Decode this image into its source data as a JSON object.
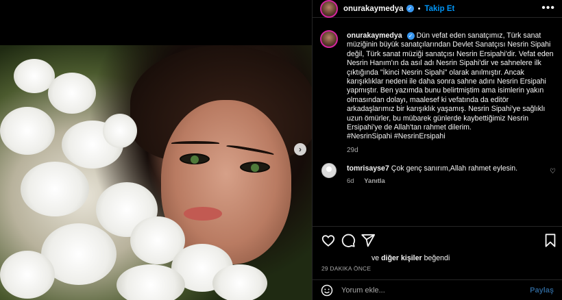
{
  "header": {
    "username": "onurakaymedya",
    "follow_label": "Takip Et",
    "dot": "•",
    "more_label": "•••"
  },
  "caption": {
    "username": "onurakaymedya",
    "text": "Dün vefat eden sanatçımız, Türk sanat müziğinin büyük sanatçılarından Devlet Sanatçısı Nesrin Sipahi değil, Türk sanat müziği sanatçısı Nesrin Ersipahi'dir. Vefat eden Nesrin Hanım'ın da asıl adı Nesrin Sipahi'dir ve sahnelere ilk çıktığında \"İkinci Nesrin Sipahi\" olarak anılmıştır. Ancak karışıklıklar nedeni ile daha sonra sahne adını Nesrin Ersipahi yapmıştır. Ben yazımda bunu belirtmiştim ama isimlerin yakın olmasından dolayı, maalesef ki vefatında da editör arkadaşlarımız bir karışıklık yaşamış. Nesrin Sipahi'ye sağlıklı uzun ömürler, bu mübarek günlerde kaybettiğimiz Nesrin Ersipahi'ye de Allah'tan rahmet dilerim.",
    "hashtags": "#NesrinSipahi #NesrinErsipahi",
    "time": "29d"
  },
  "comment": {
    "username": "tomrisayse7",
    "text": "Çok genç sanırım,Allah rahmet eylesin.",
    "time": "6d",
    "reply_label": "Yanıtla"
  },
  "likes": {
    "prefix": "ve",
    "others": "diğer kişiler",
    "suffix": "beğendi"
  },
  "time_ago": "29 dakika önce",
  "composer": {
    "placeholder": "Yorum ekle...",
    "post_label": "Paylaş"
  },
  "icons": {
    "verified": "verified-badge-icon",
    "like": "heart-icon",
    "comment": "comment-icon",
    "share": "share-icon",
    "save": "bookmark-icon",
    "emoji": "emoji-icon",
    "next": "chevron-right-icon"
  },
  "colors": {
    "background": "#000000",
    "link": "#0095f6",
    "muted": "#a8a8a8",
    "verified": "#3897f0"
  }
}
